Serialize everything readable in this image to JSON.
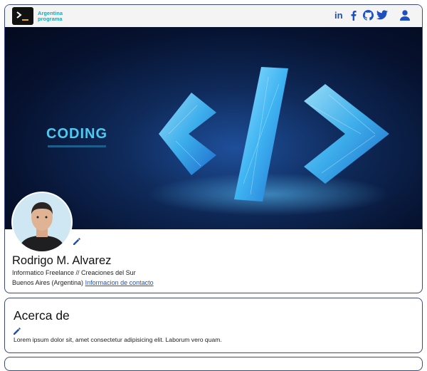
{
  "header": {
    "logo_text_line1": "Argentina",
    "logo_text_line2": "programa",
    "social_icons": [
      "linkedin-icon",
      "facebook-icon",
      "github-icon",
      "twitter-icon"
    ],
    "user_icon": "user-icon",
    "accent_color": "#1d4fbf"
  },
  "banner": {
    "heading": "CODING"
  },
  "profile": {
    "name": "Rodrigo M. Alvarez",
    "tagline": "Informatico Freelance // Creaciones del Sur",
    "location": "Buenos Aires (Argentina)",
    "contact_link": "Informacion de contacto"
  },
  "about": {
    "title": "Acerca de",
    "text": "Lorem ipsum dolor sit, amet consectetur adipisicing elit. Laborum vero quam."
  }
}
